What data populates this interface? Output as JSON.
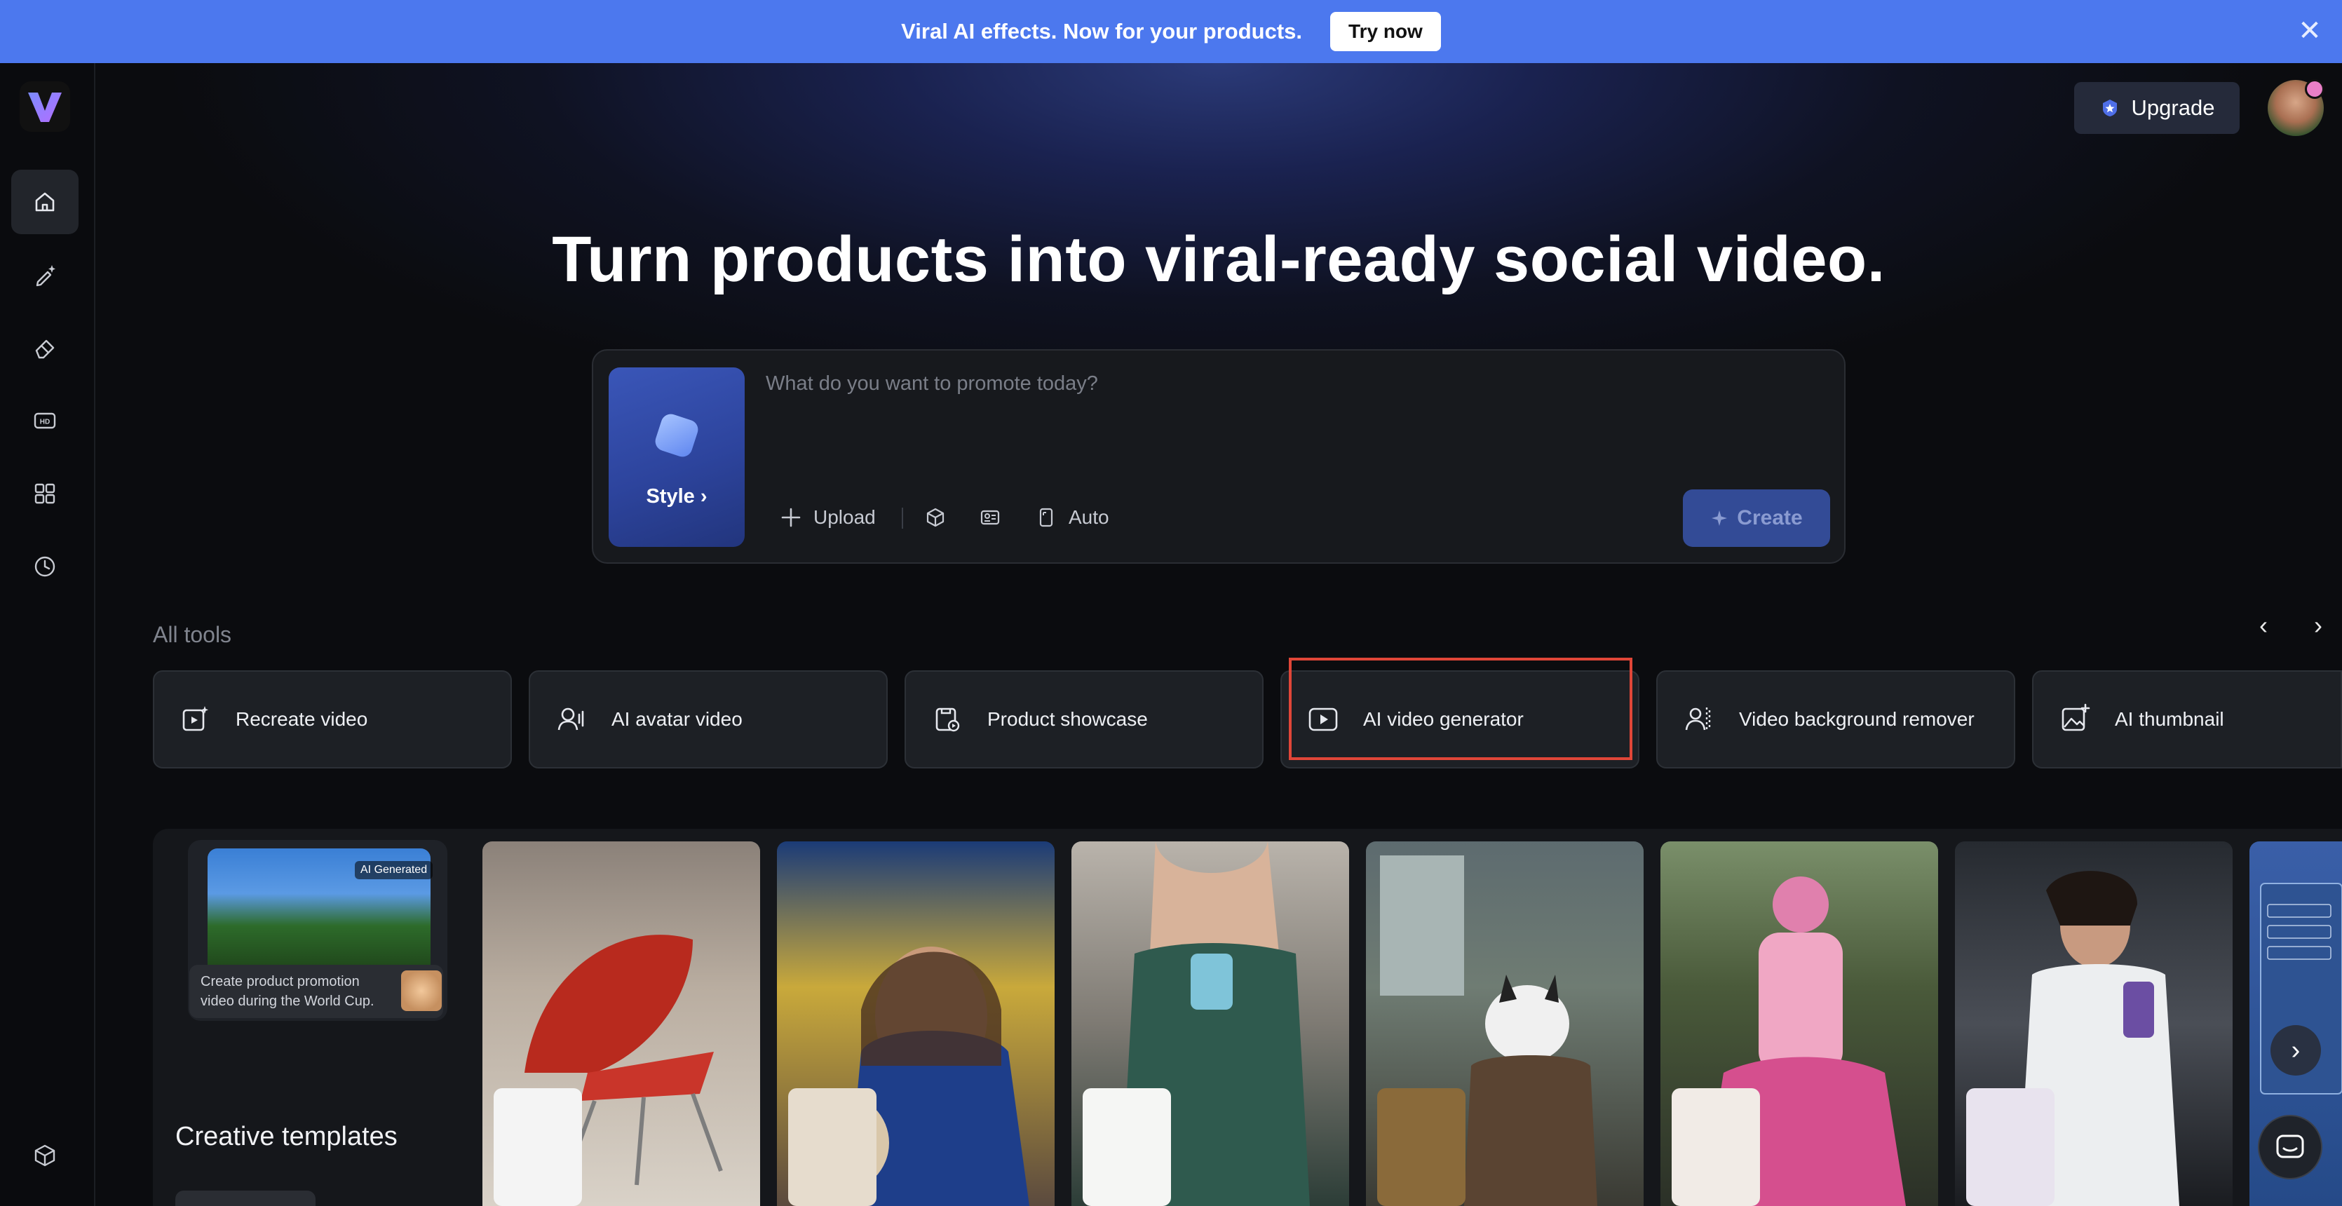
{
  "banner": {
    "text": "Viral AI effects. Now for your products.",
    "button": "Try now",
    "close_icon": "close-icon"
  },
  "sidebar": {
    "logo": "V",
    "items": [
      {
        "icon": "home-icon",
        "active": true
      },
      {
        "icon": "sparkle-pen-icon",
        "active": false
      },
      {
        "icon": "eraser-icon",
        "active": false
      },
      {
        "icon": "hd-icon",
        "active": false
      },
      {
        "icon": "apps-grid-icon",
        "active": false
      },
      {
        "icon": "history-clock-icon",
        "active": false
      }
    ],
    "bottom_icon": "package-icon"
  },
  "header": {
    "upgrade_label": "Upgrade"
  },
  "hero": {
    "headline": "Turn products into viral-ready social video."
  },
  "prompt": {
    "style_label": "Style",
    "placeholder": "What do you want to promote today?",
    "upload_label": "Upload",
    "auto_label": "Auto",
    "create_label": "Create"
  },
  "tools": {
    "section_label": "All tools",
    "items": [
      {
        "label": "Recreate video",
        "icon": "recreate-video-icon"
      },
      {
        "label": "AI avatar video",
        "icon": "avatar-voice-icon"
      },
      {
        "label": "Product showcase",
        "icon": "product-showcase-icon"
      },
      {
        "label": "AI video generator",
        "icon": "play-video-icon"
      },
      {
        "label": "Video background remover",
        "icon": "person-remove-bg-icon"
      },
      {
        "label": "AI thumbnail",
        "icon": "image-plus-icon"
      }
    ]
  },
  "templates": {
    "title": "Creative templates",
    "preview_badge": "AI Generated",
    "preview_caption": "Create product promotion video during the World Cup."
  },
  "colors": {
    "banner": "#4c78ee",
    "highlight": "#e04638",
    "create": "#334b96"
  }
}
